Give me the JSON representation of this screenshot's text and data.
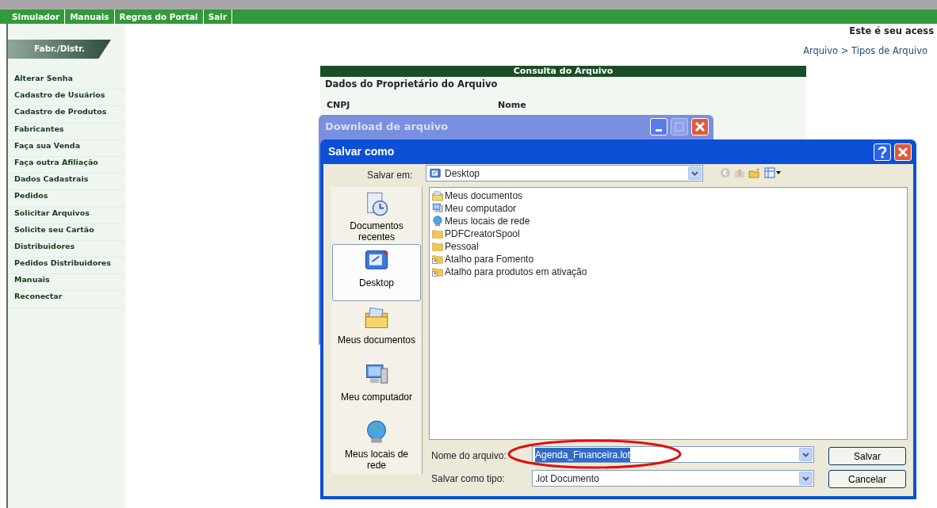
{
  "top_nav": [
    "Simulador",
    "Manuais",
    "Regras do Portal",
    "Sair"
  ],
  "sidebar": {
    "title": "Fabr./Distr.",
    "items": [
      "Alterar Senha",
      "Cadastro de Usuários",
      "Cadastro de Produtos",
      "Fabricantes",
      "Faça sua Venda",
      "Faça outra Afiliação",
      "Dados Cadastrais",
      "Pedidos",
      "Solicitar Arquivos",
      "Solicite seu Cartão",
      "Distribuidores",
      "Pedidos Distribuidores",
      "Manuais",
      "Reconectar"
    ]
  },
  "welcome": "Este é seu acess",
  "breadcrumb": "Arquivo > Tipos de Arquivo",
  "consulta": {
    "title": "Consulta do Arquivo",
    "section": "Dados do Proprietário do Arquivo",
    "columns": [
      "CNPJ",
      "Nome"
    ]
  },
  "download_window": {
    "title": "Download de arquivo"
  },
  "save_dialog": {
    "title": "Salvar como",
    "save_in_label": "Salvar em:",
    "save_in_value": "Desktop",
    "places": [
      {
        "label": "Documentos recentes",
        "kind": "recent",
        "selected": false
      },
      {
        "label": "Desktop",
        "kind": "desktop",
        "selected": true
      },
      {
        "label": "Meus documentos",
        "kind": "documents",
        "selected": false
      },
      {
        "label": "Meu computador",
        "kind": "computer",
        "selected": false
      },
      {
        "label": "Meus locais de rede",
        "kind": "network",
        "selected": false
      }
    ],
    "files": [
      {
        "name": "Meus documentos",
        "kind": "documents"
      },
      {
        "name": "Meu computador",
        "kind": "computer"
      },
      {
        "name": "Meus locais de rede",
        "kind": "network"
      },
      {
        "name": "PDFCreatorSpool",
        "kind": "folder"
      },
      {
        "name": "Pessoal",
        "kind": "folder"
      },
      {
        "name": "Atalho para Fomento",
        "kind": "shortcut"
      },
      {
        "name": "Atalho para produtos em ativação",
        "kind": "shortcut"
      }
    ],
    "filename_label": "Nome do arquivo:",
    "filename_value": "Agenda_Financeira.lot",
    "filename_selected": true,
    "type_label": "Salvar como tipo:",
    "type_value": ".lot Documento",
    "buttons": [
      "Salvar",
      "Cancelar"
    ]
  }
}
